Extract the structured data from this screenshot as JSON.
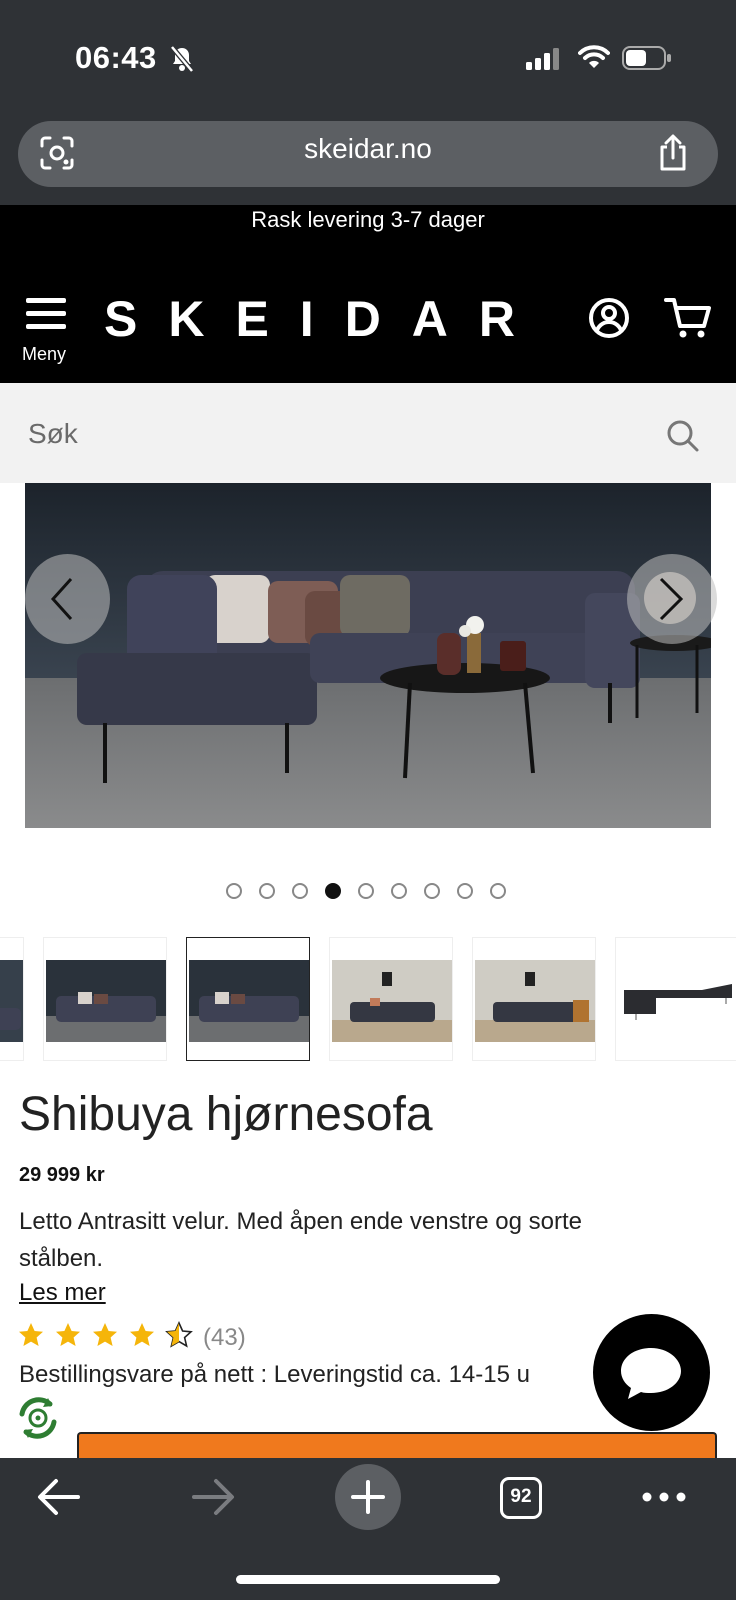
{
  "status_bar": {
    "time": "06:43"
  },
  "browser": {
    "url": "skeidar.no",
    "tab_count": "92"
  },
  "header": {
    "promo": "Rask levering 3-7 dager",
    "menu_label": "Meny",
    "logo": "SKEIDAR"
  },
  "search": {
    "placeholder": "Søk"
  },
  "gallery": {
    "image_count": 9,
    "active_index": 3
  },
  "product": {
    "title": "Shibuya hjørnesofa",
    "price": "29 999 kr",
    "description": "Letto Antrasitt velur. Med åpen ende venstre og sorte stålben.",
    "read_more": "Les mer",
    "rating": 4.5,
    "rating_count": "(43)",
    "delivery": "Bestillingsvare på nett : Leveringstid ca. 14-15 u"
  },
  "colors": {
    "browser_chrome": "#2f3236",
    "header_bg": "#000000",
    "cta": "#f0791d",
    "star": "#f5b50a",
    "recycle": "#2e7d32"
  }
}
